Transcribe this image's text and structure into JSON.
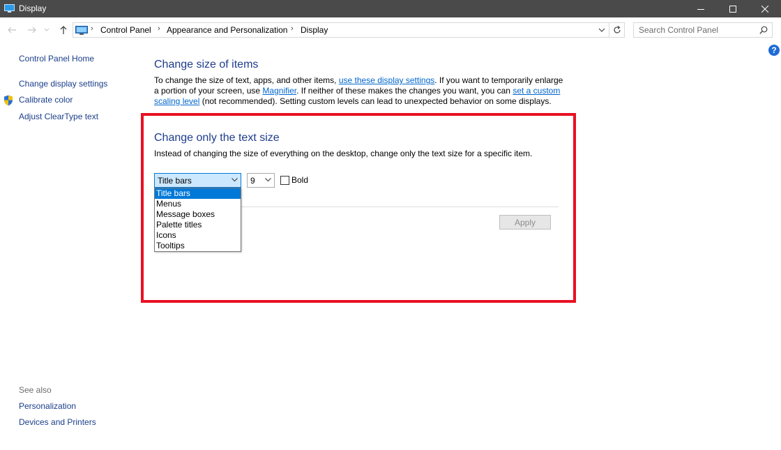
{
  "window": {
    "title": "Display"
  },
  "address": {
    "crumbs": [
      "Control Panel",
      "Appearance and Personalization",
      "Display"
    ]
  },
  "search": {
    "placeholder": "Search Control Panel"
  },
  "help": {
    "label": "?"
  },
  "sidebar": {
    "items": [
      "Control Panel Home",
      "Change display settings",
      "Calibrate color",
      "Adjust ClearType text"
    ],
    "see_also_label": "See also",
    "see_also_items": [
      "Personalization",
      "Devices and Printers"
    ]
  },
  "main": {
    "section1": {
      "title": "Change size of items",
      "p_line1_a": "To change the size of text, apps, and other items, ",
      "p_link1": "use these display settings",
      "p_line1_b": ".  If you want to temporarily enlarge",
      "p_line2_a": "a portion of your screen, use ",
      "p_link2": "Magnifier",
      "p_line2_b": ".  If neither of these makes the changes you want, you can ",
      "p_link3a": "set a custom",
      "p_link3b": "scaling level",
      "p_line3_b": " (not recommended).  Setting custom levels can lead to unexpected behavior on some displays."
    },
    "section2": {
      "title": "Change only the text size",
      "description": "Instead of changing the size of everything on the desktop, change only the text size for a specific item.",
      "item_select_value": "Title bars",
      "size_select_value": "9",
      "bold_label": "Bold",
      "dropdown_options": [
        "Title bars",
        "Menus",
        "Message boxes",
        "Palette titles",
        "Icons",
        "Tooltips"
      ],
      "apply_label": "Apply"
    }
  },
  "colors": {
    "highlight_border": "#e81123",
    "link": "#0066cc",
    "heading": "#1e3c8c",
    "selection": "#0078d7"
  }
}
